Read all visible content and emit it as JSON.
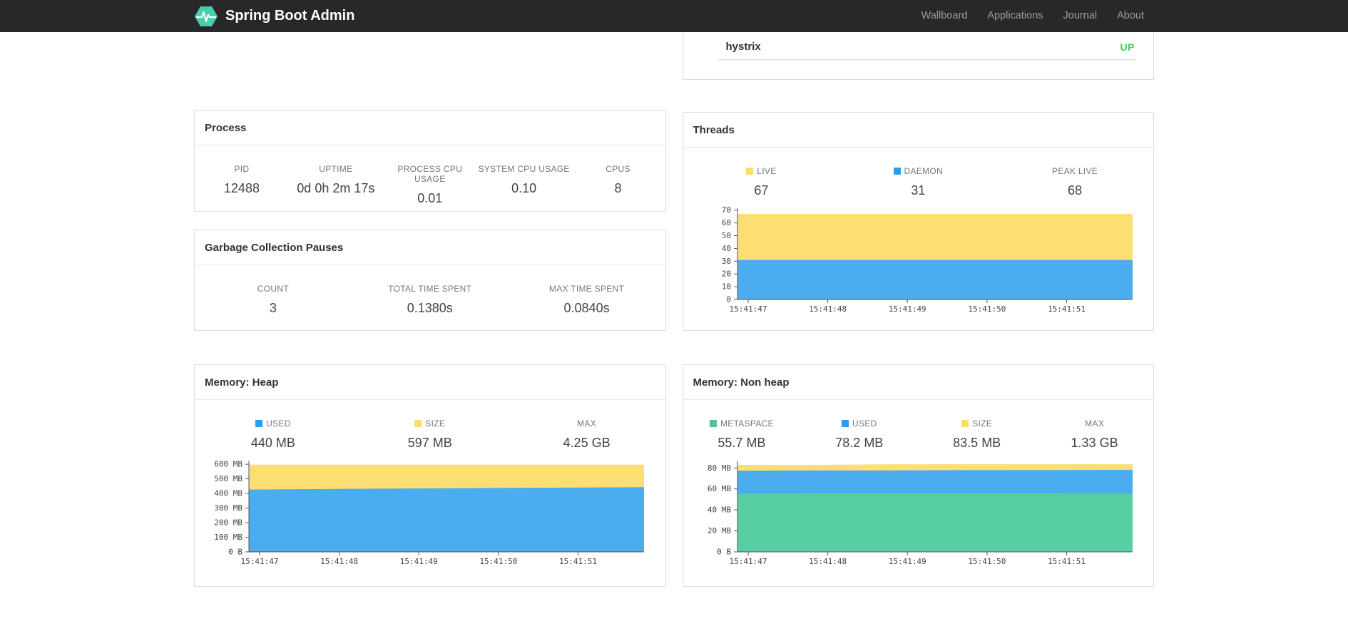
{
  "navbar": {
    "brand": "Spring Boot Admin",
    "items": [
      {
        "label": "Wallboard"
      },
      {
        "label": "Applications"
      },
      {
        "label": "Journal"
      },
      {
        "label": "About"
      }
    ]
  },
  "status_card": {
    "application": "hystrix",
    "status": "UP",
    "status_color": "#3ED154"
  },
  "cards": {
    "process": {
      "title": "Process",
      "metrics": [
        {
          "label": "PID",
          "value": "12488"
        },
        {
          "label": "UPTIME",
          "value": "0d 0h 2m 17s"
        },
        {
          "label": "PROCESS CPU USAGE",
          "value": "0.01"
        },
        {
          "label": "SYSTEM CPU USAGE",
          "value": "0.10"
        },
        {
          "label": "CPUS",
          "value": "8"
        }
      ]
    },
    "gc": {
      "title": "Garbage Collection Pauses",
      "metrics": [
        {
          "label": "COUNT",
          "value": "3"
        },
        {
          "label": "TOTAL TIME SPENT",
          "value": "0.1380s"
        },
        {
          "label": "MAX TIME SPENT",
          "value": "0.0840s"
        }
      ]
    },
    "threads": {
      "title": "Threads",
      "legend": [
        {
          "label": "LIVE",
          "value": "67",
          "color": "#FBDC6E"
        },
        {
          "label": "DAEMON",
          "value": "31",
          "color": "#2D9CEA"
        },
        {
          "label": "PEAK LIVE",
          "value": "68",
          "color": ""
        }
      ]
    },
    "heap": {
      "title": "Memory: Heap",
      "legend": [
        {
          "label": "USED",
          "value": "440 MB",
          "color": "#2D9CEA"
        },
        {
          "label": "SIZE",
          "value": "597 MB",
          "color": "#FBDC6E"
        },
        {
          "label": "MAX",
          "value": "4.25 GB",
          "color": ""
        }
      ]
    },
    "nonheap": {
      "title": "Memory: Non heap",
      "legend": [
        {
          "label": "METASPACE",
          "value": "55.7 MB",
          "color": "#4DC68F"
        },
        {
          "label": "USED",
          "value": "78.2 MB",
          "color": "#2D9CEA"
        },
        {
          "label": "SIZE",
          "value": "83.5 MB",
          "color": "#FBDC6E"
        },
        {
          "label": "MAX",
          "value": "1.33 GB",
          "color": ""
        }
      ]
    }
  },
  "chart_data": [
    {
      "type": "area",
      "title": "Threads",
      "xlabel": "",
      "ylabel": "",
      "x": [
        "15:41:47",
        "15:41:48",
        "15:41:49",
        "15:41:50",
        "15:41:51"
      ],
      "ylim": [
        0,
        71.5
      ],
      "ymax": 71.5,
      "grid": false,
      "legend_position": "top",
      "yticks": [
        {
          "v": 0,
          "label": "0"
        },
        {
          "v": 10,
          "label": "10"
        },
        {
          "v": 20,
          "label": "20"
        },
        {
          "v": 30,
          "label": "30"
        },
        {
          "v": 40,
          "label": "40"
        },
        {
          "v": 50,
          "label": "50"
        },
        {
          "v": 60,
          "label": "60"
        },
        {
          "v": 70,
          "label": "70"
        }
      ],
      "series": [
        {
          "name": "LIVE",
          "color": "#FCDE73",
          "values": [
            67,
            67,
            67,
            67,
            67,
            67
          ]
        },
        {
          "name": "DAEMON",
          "color": "#4BACEF",
          "values": [
            31,
            31,
            31,
            31,
            31,
            31
          ]
        }
      ]
    },
    {
      "type": "area",
      "title": "Memory: Heap",
      "xlabel": "",
      "ylabel": "",
      "x": [
        "15:41:47",
        "15:41:48",
        "15:41:49",
        "15:41:50",
        "15:41:51"
      ],
      "ylim": [
        0,
        625
      ],
      "ymax": 625,
      "grid": false,
      "legend_position": "top",
      "yticks": [
        {
          "v": 0,
          "label": "0 B"
        },
        {
          "v": 100,
          "label": "100 MB"
        },
        {
          "v": 200,
          "label": "200 MB"
        },
        {
          "v": 300,
          "label": "300 MB"
        },
        {
          "v": 400,
          "label": "400 MB"
        },
        {
          "v": 500,
          "label": "500 MB"
        },
        {
          "v": 600,
          "label": "600 MB"
        }
      ],
      "series": [
        {
          "name": "SIZE",
          "color": "#FCDE73",
          "values": [
            597,
            597,
            597,
            597,
            597,
            597
          ]
        },
        {
          "name": "USED",
          "color": "#4BACEF",
          "values": [
            427,
            430,
            434,
            437,
            440,
            443
          ]
        }
      ]
    },
    {
      "type": "area",
      "title": "Memory: Non heap",
      "xlabel": "",
      "ylabel": "",
      "x": [
        "15:41:47",
        "15:41:48",
        "15:41:49",
        "15:41:50",
        "15:41:51"
      ],
      "ylim": [
        0,
        87
      ],
      "ymax": 87,
      "grid": false,
      "legend_position": "top",
      "yticks": [
        {
          "v": 0,
          "label": "0 B"
        },
        {
          "v": 20,
          "label": "20 MB"
        },
        {
          "v": 40,
          "label": "40 MB"
        },
        {
          "v": 60,
          "label": "60 MB"
        },
        {
          "v": 80,
          "label": "80 MB"
        }
      ],
      "series": [
        {
          "name": "SIZE",
          "color": "#FCDE73",
          "values": [
            82.9,
            82.9,
            83.5,
            83.5,
            83.5,
            83.5
          ]
        },
        {
          "name": "USED",
          "color": "#4BACEF",
          "values": [
            77.4,
            77.6,
            77.7,
            77.9,
            78.0,
            78.2
          ]
        },
        {
          "name": "METASPACE",
          "color": "#57CFA2",
          "values": [
            55.4,
            55.5,
            55.5,
            55.6,
            55.6,
            55.7
          ]
        }
      ]
    }
  ]
}
